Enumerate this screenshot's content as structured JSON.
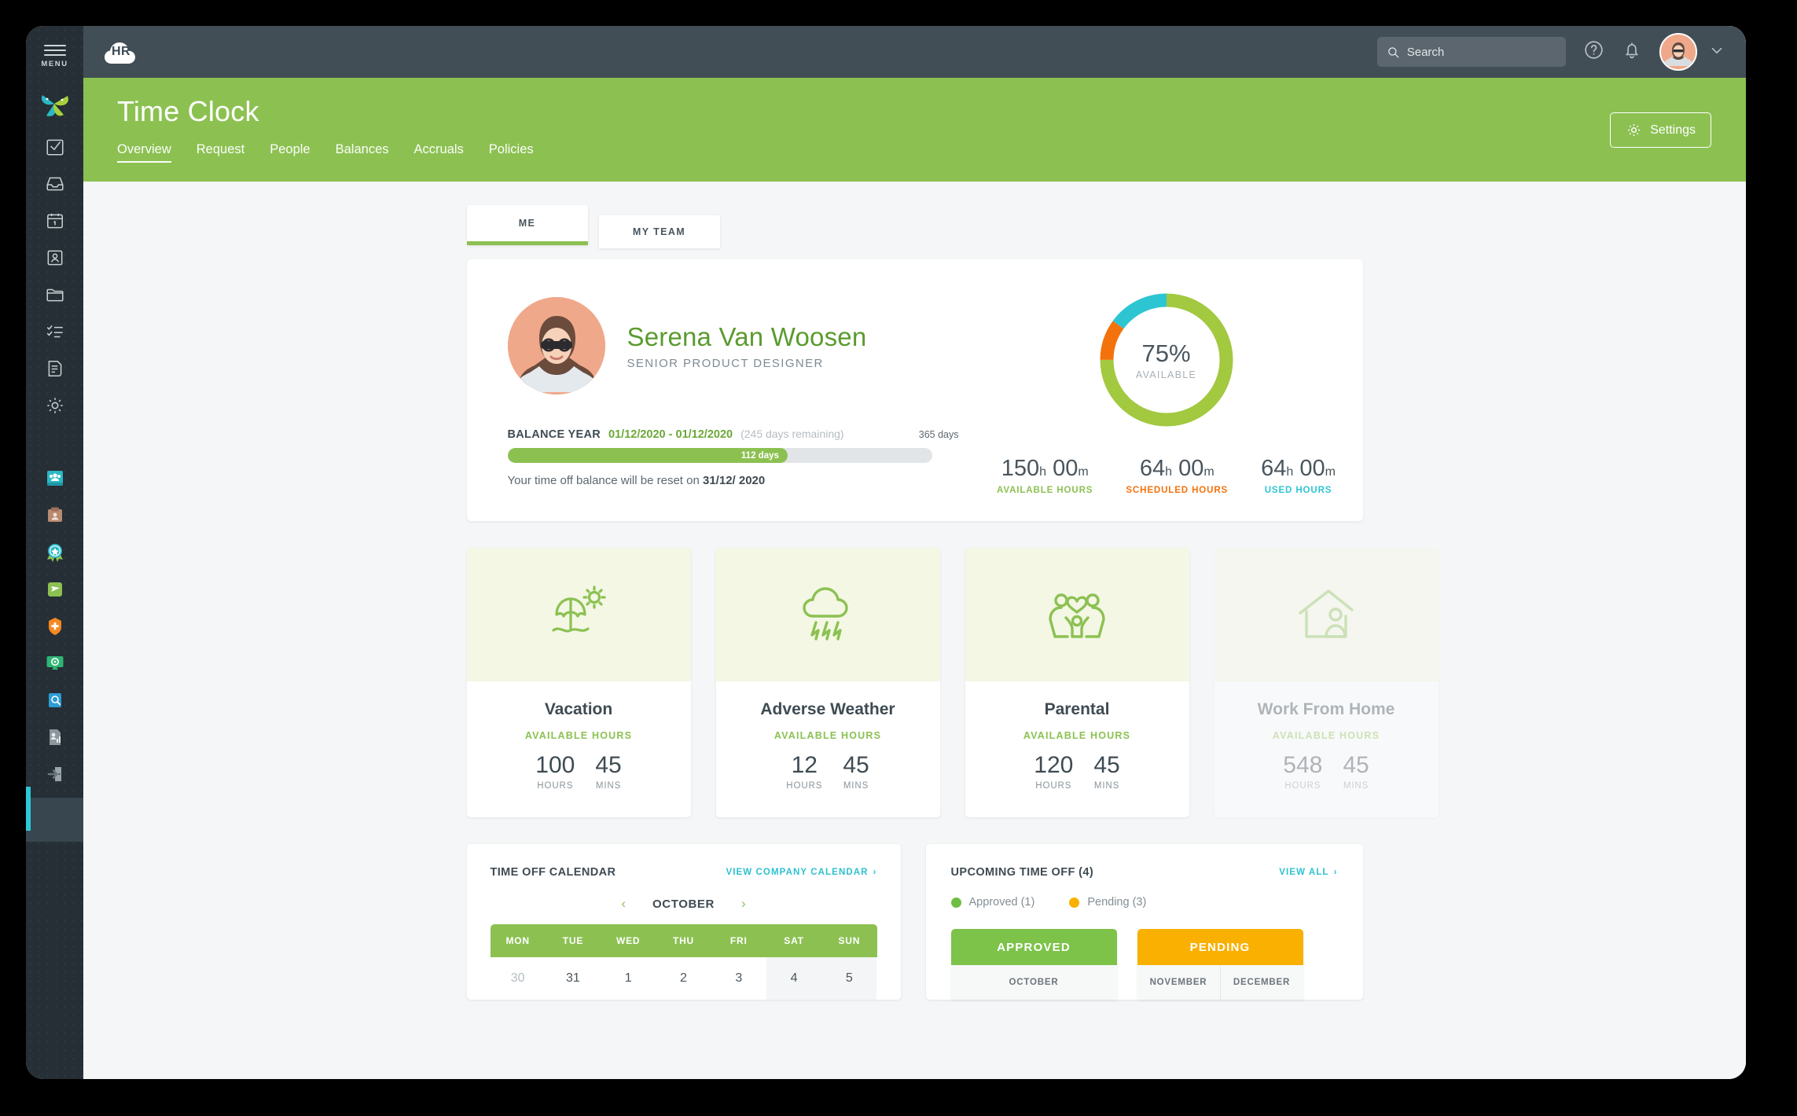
{
  "rail": {
    "menu_label": "MENU",
    "logo_name": "app-logo-star",
    "icons": [
      {
        "name": "tasks-checkbox-icon"
      },
      {
        "name": "inbox-tray-icon"
      },
      {
        "name": "calendar-icon"
      },
      {
        "name": "employee-card-icon"
      },
      {
        "name": "folder-icon"
      },
      {
        "name": "checklist-icon"
      },
      {
        "name": "document-icon"
      },
      {
        "name": "settings-gear-icon"
      }
    ],
    "app_icons": [
      {
        "name": "team-directory-icon",
        "color": "#2bb8c4"
      },
      {
        "name": "recruitment-clipboard-icon",
        "color": "#b98b72"
      },
      {
        "name": "performance-badge-icon",
        "color": "#2bb8c4"
      },
      {
        "name": "time-off-plane-icon",
        "color": "#8cc152"
      },
      {
        "name": "benefits-shield-icon",
        "color": "#f5881f"
      },
      {
        "name": "monitor-analytics-icon",
        "color": "#2fb573"
      },
      {
        "name": "audit-search-icon",
        "color": "#2d9cd8"
      },
      {
        "name": "reports-icon",
        "color": "#8b969d"
      },
      {
        "name": "logout-icon",
        "color": "#8b969d"
      }
    ]
  },
  "topbar": {
    "logo_text": "HR",
    "search": {
      "placeholder": "Search",
      "value": ""
    },
    "help_icon": "help-circle-icon",
    "bell_icon": "notification-bell-icon",
    "avatar_name": "user-avatar",
    "chevron": "chevron-down-icon"
  },
  "header": {
    "title": "Time Clock",
    "settings_label": "Settings",
    "settings_icon": "gear-icon",
    "tabs": [
      {
        "label": "Overview",
        "active": true
      },
      {
        "label": "Request",
        "active": false
      },
      {
        "label": "People",
        "active": false
      },
      {
        "label": "Balances",
        "active": false
      },
      {
        "label": "Accruals",
        "active": false
      },
      {
        "label": "Policies",
        "active": false
      }
    ]
  },
  "scope_toggle": [
    {
      "label": "ME",
      "active": true
    },
    {
      "label": "MY TEAM",
      "active": false
    }
  ],
  "profile": {
    "name": "Serena Van Woosen",
    "role": "SENIOR PRODUCT DESIGNER",
    "balance_label": "BALANCE YEAR",
    "balance_range": "01/12/2020 - 01/12/2020",
    "days_remaining": "(245 days remaining)",
    "total_days": "365 days",
    "elapsed_days": "112 days",
    "progress_percent": 66,
    "reset_prefix": "Your time off balance will be reset on",
    "reset_date": "31/12/ 2020"
  },
  "chart_data": {
    "type": "pie",
    "title": "Time off balance",
    "center_value": "75%",
    "center_label": "AVAILABLE",
    "categories": [
      "Available",
      "Scheduled",
      "Used"
    ],
    "values": [
      75,
      10,
      15
    ],
    "colors": [
      "#a2c93f",
      "#f4720c",
      "#2ec5d3"
    ],
    "legend": [
      {
        "name": "AVAILABLE HOURS",
        "hours": "150",
        "mins": "00",
        "color": "#8cc152"
      },
      {
        "name": "SCHEDULED HOURS",
        "hours": "64",
        "mins": "00",
        "color": "#f4720c"
      },
      {
        "name": "USED HOURS",
        "hours": "64",
        "mins": "00",
        "color": "#2ec5d3"
      }
    ]
  },
  "categories": [
    {
      "title": "Vacation",
      "sub": "AVAILABLE HOURS",
      "hours": "100",
      "mins": "45",
      "hours_unit": "HOURS",
      "mins_unit": "MINS",
      "icon": "beach-umbrella-sun-icon",
      "faded": false
    },
    {
      "title": "Adverse Weather",
      "sub": "AVAILABLE HOURS",
      "hours": "12",
      "mins": "45",
      "hours_unit": "HOURS",
      "mins_unit": "MINS",
      "icon": "rain-cloud-icon",
      "faded": false
    },
    {
      "title": "Parental",
      "sub": "AVAILABLE HOURS",
      "hours": "120",
      "mins": "45",
      "hours_unit": "HOURS",
      "mins_unit": "MINS",
      "icon": "family-heart-icon",
      "faded": false
    },
    {
      "title": "Work From Home",
      "sub": "AVAILABLE HOURS",
      "hours": "548",
      "mins": "45",
      "hours_unit": "HOURS",
      "mins_unit": "MINS",
      "icon": "house-person-icon",
      "faded": true
    }
  ],
  "calendar": {
    "title": "TIME OFF CALENDAR",
    "link": "VIEW COMPANY CALENDAR",
    "prev_icon": "chevron-left-icon",
    "next_icon": "chevron-right-icon",
    "month": "OCTOBER",
    "weekdays": [
      "MON",
      "TUE",
      "WED",
      "THU",
      "FRI",
      "SAT",
      "SUN"
    ],
    "week1": [
      {
        "d": "30",
        "muted": true,
        "weekend": false
      },
      {
        "d": "31",
        "muted": false,
        "weekend": false
      },
      {
        "d": "1",
        "muted": false,
        "weekend": false
      },
      {
        "d": "2",
        "muted": false,
        "weekend": false
      },
      {
        "d": "3",
        "muted": false,
        "weekend": false
      },
      {
        "d": "4",
        "muted": false,
        "weekend": true
      },
      {
        "d": "5",
        "muted": false,
        "weekend": true
      }
    ]
  },
  "upcoming": {
    "title": "UPCOMING TIME OFF (4)",
    "link": "VIEW ALL",
    "legend": [
      {
        "label": "Approved (1)",
        "color": "#6ebe44"
      },
      {
        "label": "Pending (3)",
        "color": "#f9b000"
      }
    ],
    "cards": [
      {
        "status": "APPROVED",
        "color": "#7dc34a",
        "months": [
          "OCTOBER"
        ]
      },
      {
        "status": "PENDING",
        "color": "#f9b000",
        "months": [
          "NOVEMBER",
          "DECEMBER"
        ]
      }
    ]
  }
}
